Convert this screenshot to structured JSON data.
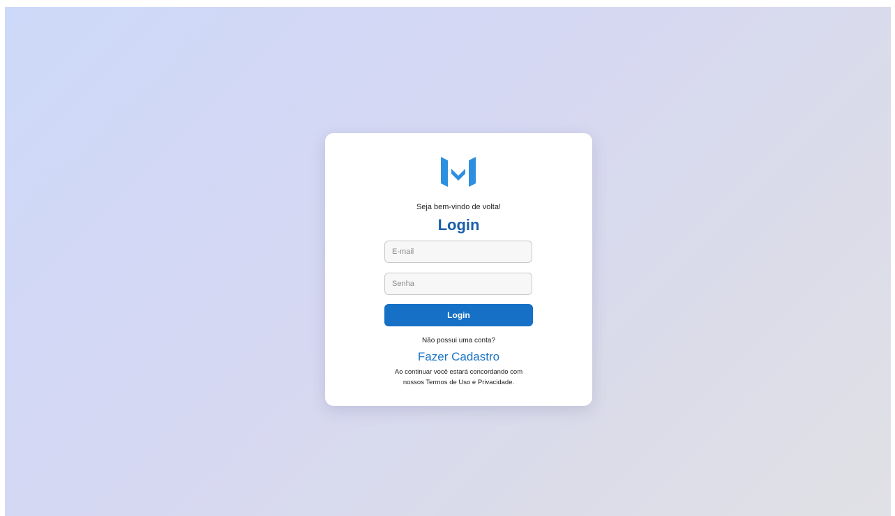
{
  "login": {
    "logo_icon": "m-logo-icon",
    "brand_color": "#1a73c4",
    "welcome_text": "Seja bem-vindo de volta!",
    "title": "Login",
    "email_placeholder": "E-mail",
    "password_placeholder": "Senha",
    "login_button_label": "Login",
    "no_account_text": "Não possui uma conta?",
    "signup_link_label": "Fazer Cadastro",
    "terms_line_1": "Ao continuar você estará concordando com",
    "terms_line_2": "nossos Termos de Uso e Privacidade."
  }
}
